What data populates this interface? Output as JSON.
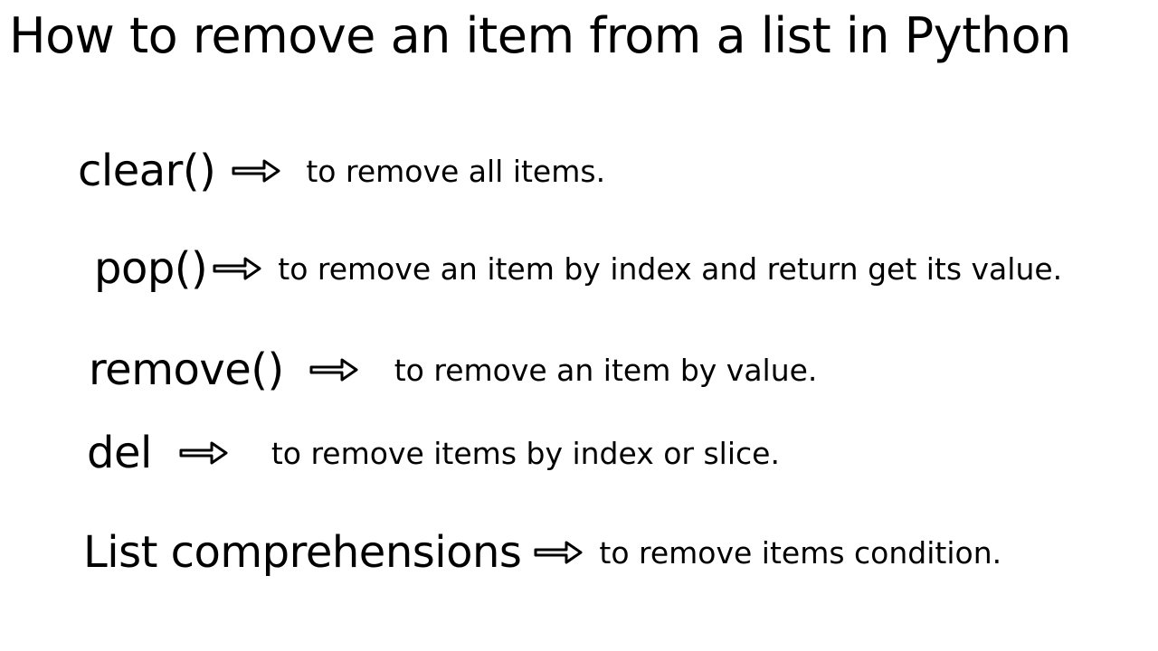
{
  "title": "How to remove an item from a list in Python",
  "items": [
    {
      "method": "clear()",
      "desc": "to remove all items."
    },
    {
      "method": "pop()",
      "desc": "to remove an item by index and return get its value."
    },
    {
      "method": "remove()",
      "desc": "to remove an item by value."
    },
    {
      "method": "del",
      "desc": "to remove items by index or slice."
    },
    {
      "method": "List comprehensions",
      "desc": "to remove items condition."
    }
  ]
}
